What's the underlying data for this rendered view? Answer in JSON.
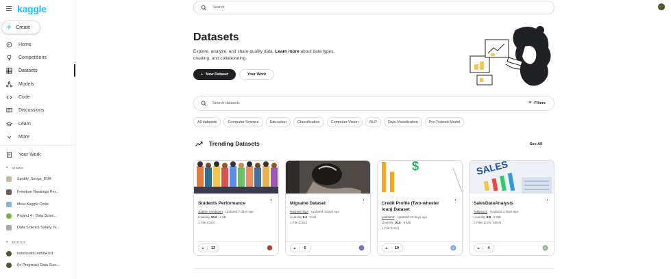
{
  "app": {
    "logo": "kaggle",
    "create_label": "Create"
  },
  "sidebar": {
    "items": [
      {
        "label": "Home",
        "icon": "home-icon"
      },
      {
        "label": "Competitions",
        "icon": "trophy-icon"
      },
      {
        "label": "Datasets",
        "icon": "table-icon"
      },
      {
        "label": "Models",
        "icon": "models-icon"
      },
      {
        "label": "Code",
        "icon": "code-icon"
      },
      {
        "label": "Discussions",
        "icon": "discussion-icon"
      },
      {
        "label": "Learn",
        "icon": "learn-icon"
      },
      {
        "label": "More",
        "icon": "chevron-down-icon"
      }
    ],
    "your_work": "Your Work",
    "views_label": "VIEWS",
    "views": [
      "Spotify_Songs_EDA",
      "Freedom Rankings Per...",
      "Meta Kaggle Code",
      "Project 4 - Data Scien...",
      "Data Science Salary: N..."
    ],
    "edited_label": "EDITED",
    "edited": [
      "notebook61ed5847d1",
      "(In Progress) Data Scie..."
    ]
  },
  "header": {
    "search_placeholder": "Search"
  },
  "hero": {
    "title": "Datasets",
    "subtitle_pre": "Explore, analyze, and share quality data. ",
    "learn_more": "Learn more",
    "subtitle_post": " about data types, creating, and collaborating.",
    "new_dataset_label": "New Dataset",
    "your_work_label": "Your Work"
  },
  "dataset_search": {
    "placeholder": "Search datasets",
    "filters_label": "Filters"
  },
  "chips": [
    "All datasets",
    "Computer Science",
    "Education",
    "Classification",
    "Computer Vision",
    "NLP",
    "Data Visualization",
    "Pre-Trained Model"
  ],
  "trending": {
    "title": "Trending Datasets",
    "see_all": "See All",
    "cards": [
      {
        "title": "Students Performance",
        "author": "Joakim Arvidsson",
        "updated": " · Updated 7 days ago",
        "usability_label": "Usability ",
        "usability": "10.0",
        "size": " · 2 kB",
        "files": "1 File (CSV)",
        "votes": "13"
      },
      {
        "title": "Migraine Dataset",
        "author": "Ranjeet Raut",
        "updated": " · Updated 3 days ago",
        "usability_label": "Usability ",
        "usability": "8.2",
        "size": " · 3 kB",
        "files": "1 File (CSV)",
        "votes": "6"
      },
      {
        "title": "Credit Profile (Two-wheeler loan) Dataset",
        "author": "yashkmd",
        "updated": " · Updated 10 days ago",
        "usability_label": "Usability ",
        "usability": "10.0",
        "size": " · 8 MB",
        "files": "1 File (CSV)",
        "votes": "10"
      },
      {
        "title": "SalesDataAnalysis",
        "author": "AdityaJJ1",
        "updated": " · Updated 3 days ago",
        "usability_label": "Usability ",
        "usability": "8.8",
        "size": " · 5 MB",
        "files": "2 Files (CSV, other)",
        "votes": "4"
      }
    ]
  },
  "colors": {
    "brand": "#20beff",
    "dark": "#202124",
    "border": "#dadce0"
  }
}
